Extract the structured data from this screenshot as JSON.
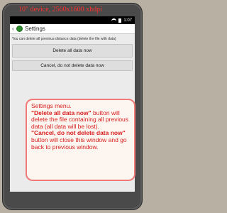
{
  "caption": "10\" device, 2560x1600 xhdpi",
  "status_bar": {
    "time": "1:07"
  },
  "action_bar": {
    "back_glyph": "‹",
    "title": "Settings"
  },
  "content": {
    "description": "You can delete all previous distance data (delete the file with data)",
    "delete_button": "Delete all data now",
    "cancel_button": "Cancel, do not delete data now"
  },
  "note": {
    "intro": "Settings menu.",
    "delete_term": "\"Delete all data now\"",
    "delete_text": " button will delete the file containing all previous data (all data will be lost).",
    "cancel_term": "\"Cancel, do not delete data now\"",
    "cancel_text": " button will close this window and go back to previous window."
  },
  "colors": {
    "annotation_red": "#d61e1e",
    "annotation_border": "#f07a7a",
    "app_icon_green": "#2e8b2e"
  },
  "icons": [
    "wifi-icon",
    "battery-icon",
    "back-chevron-icon",
    "app-icon"
  ]
}
